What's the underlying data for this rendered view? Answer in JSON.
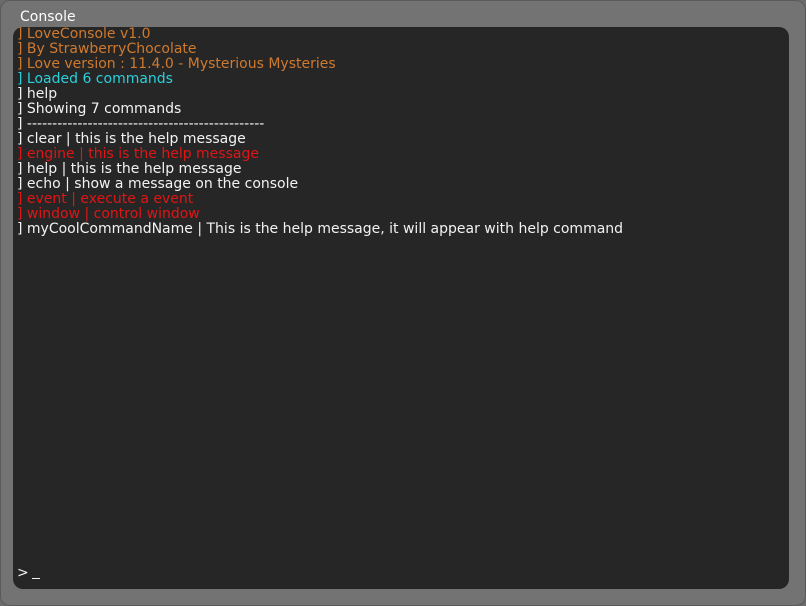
{
  "window": {
    "title": "Console"
  },
  "colors": {
    "background": "#262626",
    "frame": "#737373",
    "default_text": "#f2f2f2",
    "info": "#cf7a2e",
    "success": "#2ad0db",
    "disabled": "#e01515"
  },
  "log": [
    {
      "text": "] LoveConsole v1.0",
      "color": "orange"
    },
    {
      "text": "] By StrawberryChocolate",
      "color": "orange"
    },
    {
      "text": "] Love version : 11.4.0 - Mysterious Mysteries",
      "color": "orange"
    },
    {
      "text": "] Loaded 6 commands",
      "color": "cyan"
    },
    {
      "text": "] help",
      "color": "white"
    },
    {
      "text": "] Showing 7 commands",
      "color": "white"
    },
    {
      "text": "] -----------------------------------------------",
      "color": "white"
    },
    {
      "text": "] clear | this is the help message",
      "color": "white"
    },
    {
      "text": "] engine | this is the help message",
      "color": "red"
    },
    {
      "text": "] help | this is the help message",
      "color": "white"
    },
    {
      "text": "] echo | show a message on the console",
      "color": "white"
    },
    {
      "text": "] event | execute a event",
      "color": "red"
    },
    {
      "text": "] window | control window",
      "color": "red"
    },
    {
      "text": "] myCoolCommandName | This is the help message, it will appear with help command",
      "color": "white"
    }
  ],
  "input": {
    "prompt": ">",
    "value": ""
  }
}
